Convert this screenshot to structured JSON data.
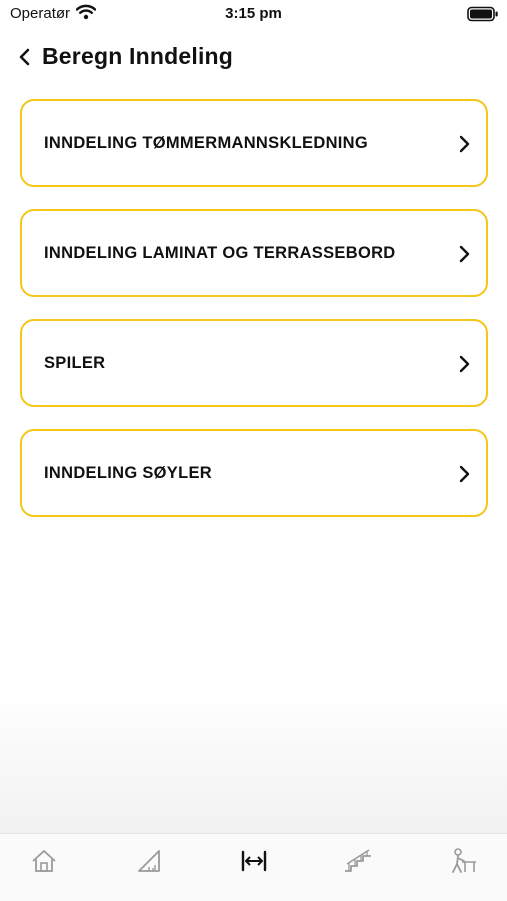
{
  "status_bar": {
    "carrier": "Operatør",
    "time": "3:15 pm"
  },
  "nav": {
    "title": "Beregn Inndeling"
  },
  "menu": [
    {
      "label": "INNDELING TØMMERMANNSKLEDNING"
    },
    {
      "label": "INNDELING LAMINAT OG TERRASSEBORD"
    },
    {
      "label": "SPILER"
    },
    {
      "label": "INNDELING SØYLER"
    }
  ],
  "tabs": [
    {
      "icon": "home-icon",
      "active": false
    },
    {
      "icon": "ruler-triangle-icon",
      "active": false
    },
    {
      "icon": "spacing-icon",
      "active": true
    },
    {
      "icon": "stairs-icon",
      "active": false
    },
    {
      "icon": "worker-icon",
      "active": false
    }
  ],
  "colors": {
    "accent_border": "#f5c518",
    "active_tab": "#111111",
    "inactive_tab": "#9a9a9a"
  }
}
